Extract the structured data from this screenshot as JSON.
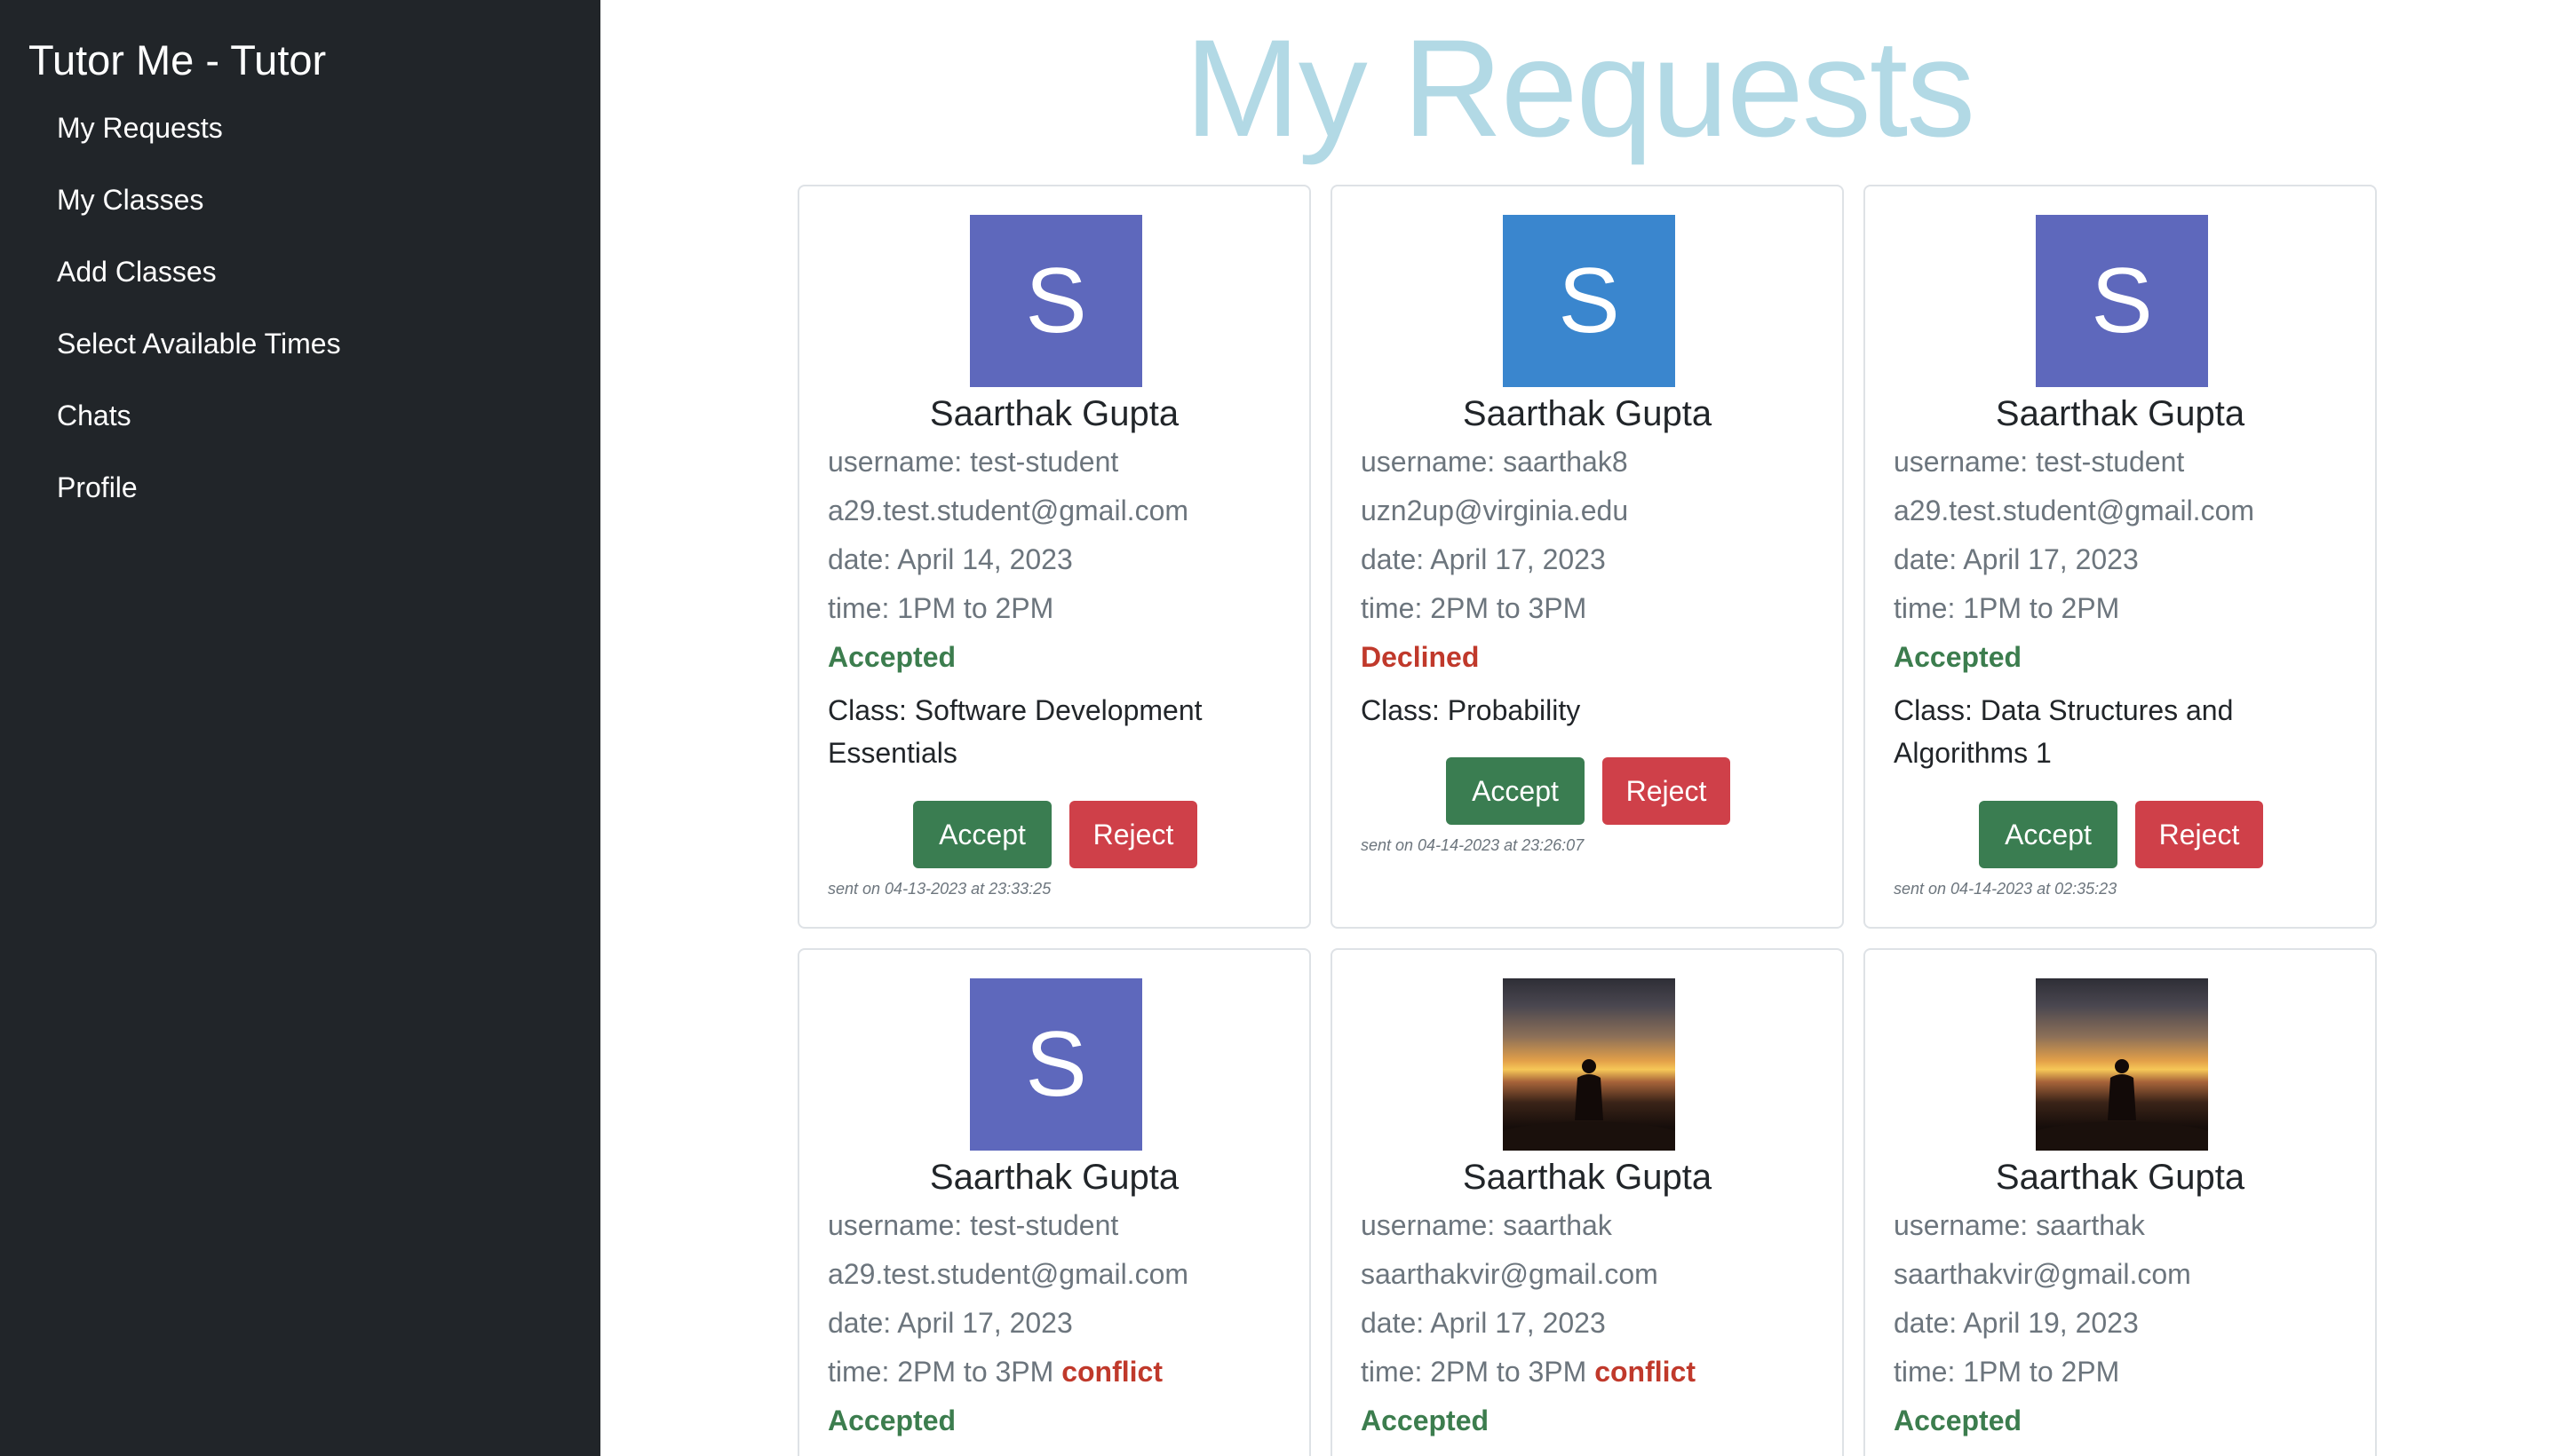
{
  "app": {
    "brand": "Tutor Me - Tutor"
  },
  "nav": [
    {
      "label": "My Requests"
    },
    {
      "label": "My Classes"
    },
    {
      "label": "Add Classes"
    },
    {
      "label": "Select Available Times"
    },
    {
      "label": "Chats"
    },
    {
      "label": "Profile"
    }
  ],
  "page": {
    "title": "My Requests"
  },
  "labels": {
    "accept": "Accept",
    "reject": "Reject",
    "conflict": "conflict"
  },
  "requests": [
    {
      "avatar": {
        "type": "letter",
        "letter": "S",
        "color": "#5e68bc"
      },
      "name": "Saarthak Gupta",
      "username": "username: test-student",
      "email": "a29.test.student@gmail.com",
      "date": "date: April 14, 2023",
      "time": "time: 1PM to 2PM",
      "status": "Accepted",
      "class_name": "Class: Software Development Essentials",
      "sent": "sent on 04-13-2023 at 23:33:25"
    },
    {
      "avatar": {
        "type": "letter",
        "letter": "S",
        "color": "#3a86ce"
      },
      "name": "Saarthak Gupta",
      "username": "username: saarthak8",
      "email": "uzn2up@virginia.edu",
      "date": "date: April 17, 2023",
      "time": "time: 2PM to 3PM",
      "status": "Declined",
      "class_name": "Class: Probability",
      "sent": "sent on 04-14-2023 at 23:26:07"
    },
    {
      "avatar": {
        "type": "letter",
        "letter": "S",
        "color": "#5e68bc"
      },
      "name": "Saarthak Gupta",
      "username": "username: test-student",
      "email": "a29.test.student@gmail.com",
      "date": "date: April 17, 2023",
      "time": "time: 1PM to 2PM",
      "status": "Accepted",
      "class_name": "Class: Data Structures and Algorithms 1",
      "sent": "sent on 04-14-2023 at 02:35:23"
    },
    {
      "avatar": {
        "type": "letter",
        "letter": "S",
        "color": "#5e68bc"
      },
      "name": "Saarthak Gupta",
      "username": "username: test-student",
      "email": "a29.test.student@gmail.com",
      "date": "date: April 17, 2023",
      "time": "time: 2PM to 3PM",
      "time_conflict": true,
      "status": "Accepted"
    },
    {
      "avatar": {
        "type": "photo",
        "description": "sunset silhouette"
      },
      "name": "Saarthak Gupta",
      "username": "username: saarthak",
      "email": "saarthakvir@gmail.com",
      "date": "date: April 17, 2023",
      "time": "time: 2PM to 3PM",
      "time_conflict": true,
      "status": "Accepted"
    },
    {
      "avatar": {
        "type": "photo",
        "description": "sunset silhouette"
      },
      "name": "Saarthak Gupta",
      "username": "username: saarthak",
      "email": "saarthakvir@gmail.com",
      "date": "date: April 19, 2023",
      "time": "time: 1PM to 2PM",
      "status": "Accepted"
    }
  ],
  "colors": {
    "sidebar_bg": "#212529",
    "title": "#b2d9e5",
    "accepted": "#3c7d4e",
    "declined": "#c0392b",
    "accept_button": "#3a7d51",
    "reject_button": "#cf4049"
  }
}
